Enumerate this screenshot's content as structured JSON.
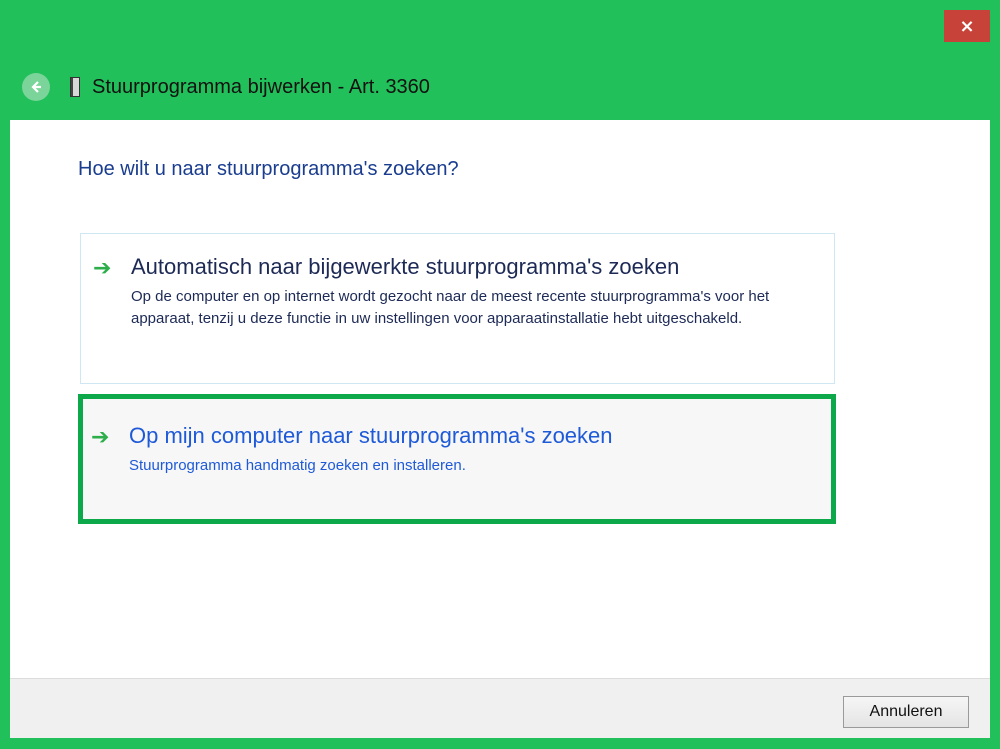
{
  "window": {
    "title": "Stuurprogramma bijwerken - Art. 3360",
    "close_label": "×"
  },
  "icons": {
    "back": "back-arrow-icon",
    "device": "device-icon",
    "option_arrow": "green-arrow-icon"
  },
  "main": {
    "question": "Hoe wilt u naar stuurprogramma's zoeken?",
    "options": [
      {
        "arrow": "➔",
        "title": "Automatisch naar bijgewerkte stuurprogramma's zoeken",
        "description": "Op de computer en op internet wordt gezocht naar de meest recente stuurprogramma's voor het apparaat, tenzij u deze functie in uw instellingen voor apparaatinstallatie hebt uitgeschakeld."
      },
      {
        "arrow": "➔",
        "title": "Op mijn computer naar stuurprogramma's zoeken",
        "description": "Stuurprogramma handmatig zoeken en installeren."
      }
    ]
  },
  "footer": {
    "cancel_label": "Annuleren"
  },
  "colors": {
    "frame": "#22c05a",
    "highlight": "#0da84a",
    "link_blue": "#1e5ad8",
    "heading_blue": "#1a3d8f",
    "close_red": "#c7433a"
  }
}
